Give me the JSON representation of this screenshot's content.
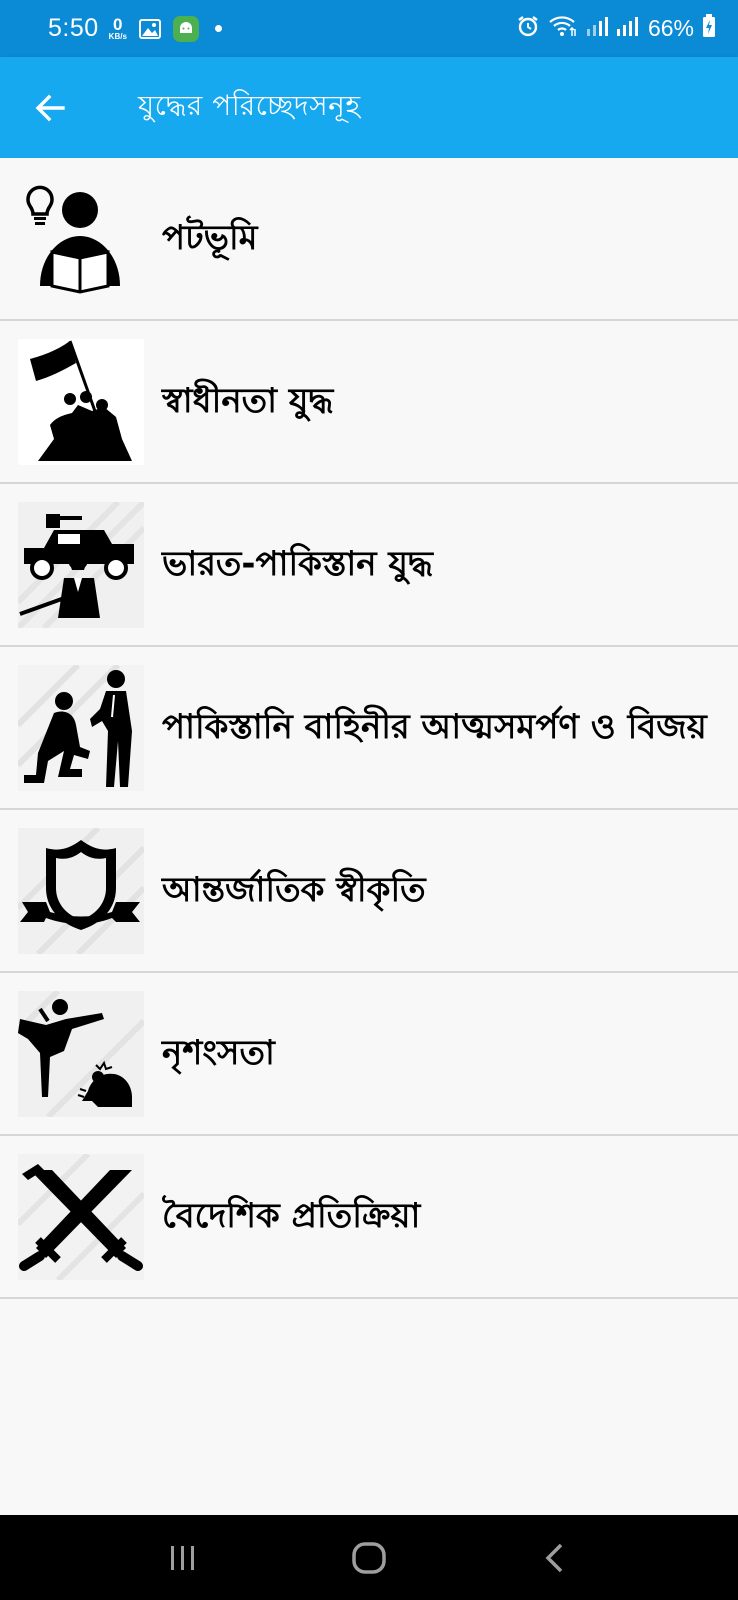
{
  "status_bar": {
    "time": "5:50",
    "net_speed": "0",
    "net_unit": "KB/s",
    "battery": "66%",
    "icons": [
      "gallery-icon",
      "android-icon",
      "alarm-icon",
      "wifi-icon",
      "signal-icon",
      "signal-icon",
      "battery-charging-icon"
    ]
  },
  "app_bar": {
    "title": "যুদ্ধের  পরিচ্ছেদসনূহ",
    "back_icon": "arrow-left-icon"
  },
  "chapters": [
    {
      "label": "পটভূমি",
      "icon": "reading-person-icon"
    },
    {
      "label": "স্বাধীনতা যুদ্ধ",
      "icon": "flag-raising-icon"
    },
    {
      "label": "ভারত-পাকিস্তান যুদ্ধ",
      "icon": "army-jeep-icon"
    },
    {
      "label": "পাকিস্তানি বাহিনীর আত্মসমর্পণ ও বিজয়",
      "icon": "surrender-icon"
    },
    {
      "label": "আন্তর্জাতিক স্বীকৃতি",
      "icon": "shield-icon"
    },
    {
      "label": "নৃশংসতা",
      "icon": "violence-icon"
    },
    {
      "label": "বৈদেশিক প্রতিক্রিয়া",
      "icon": "crossed-swords-icon"
    }
  ],
  "colors": {
    "status_bar": "#0b8ad6",
    "app_bar": "#17a9ef",
    "background": "#f8f8f8",
    "divider": "#d6d6d6"
  },
  "nav_bar": {
    "buttons": [
      "recent-apps-icon",
      "home-icon",
      "back-icon"
    ]
  }
}
